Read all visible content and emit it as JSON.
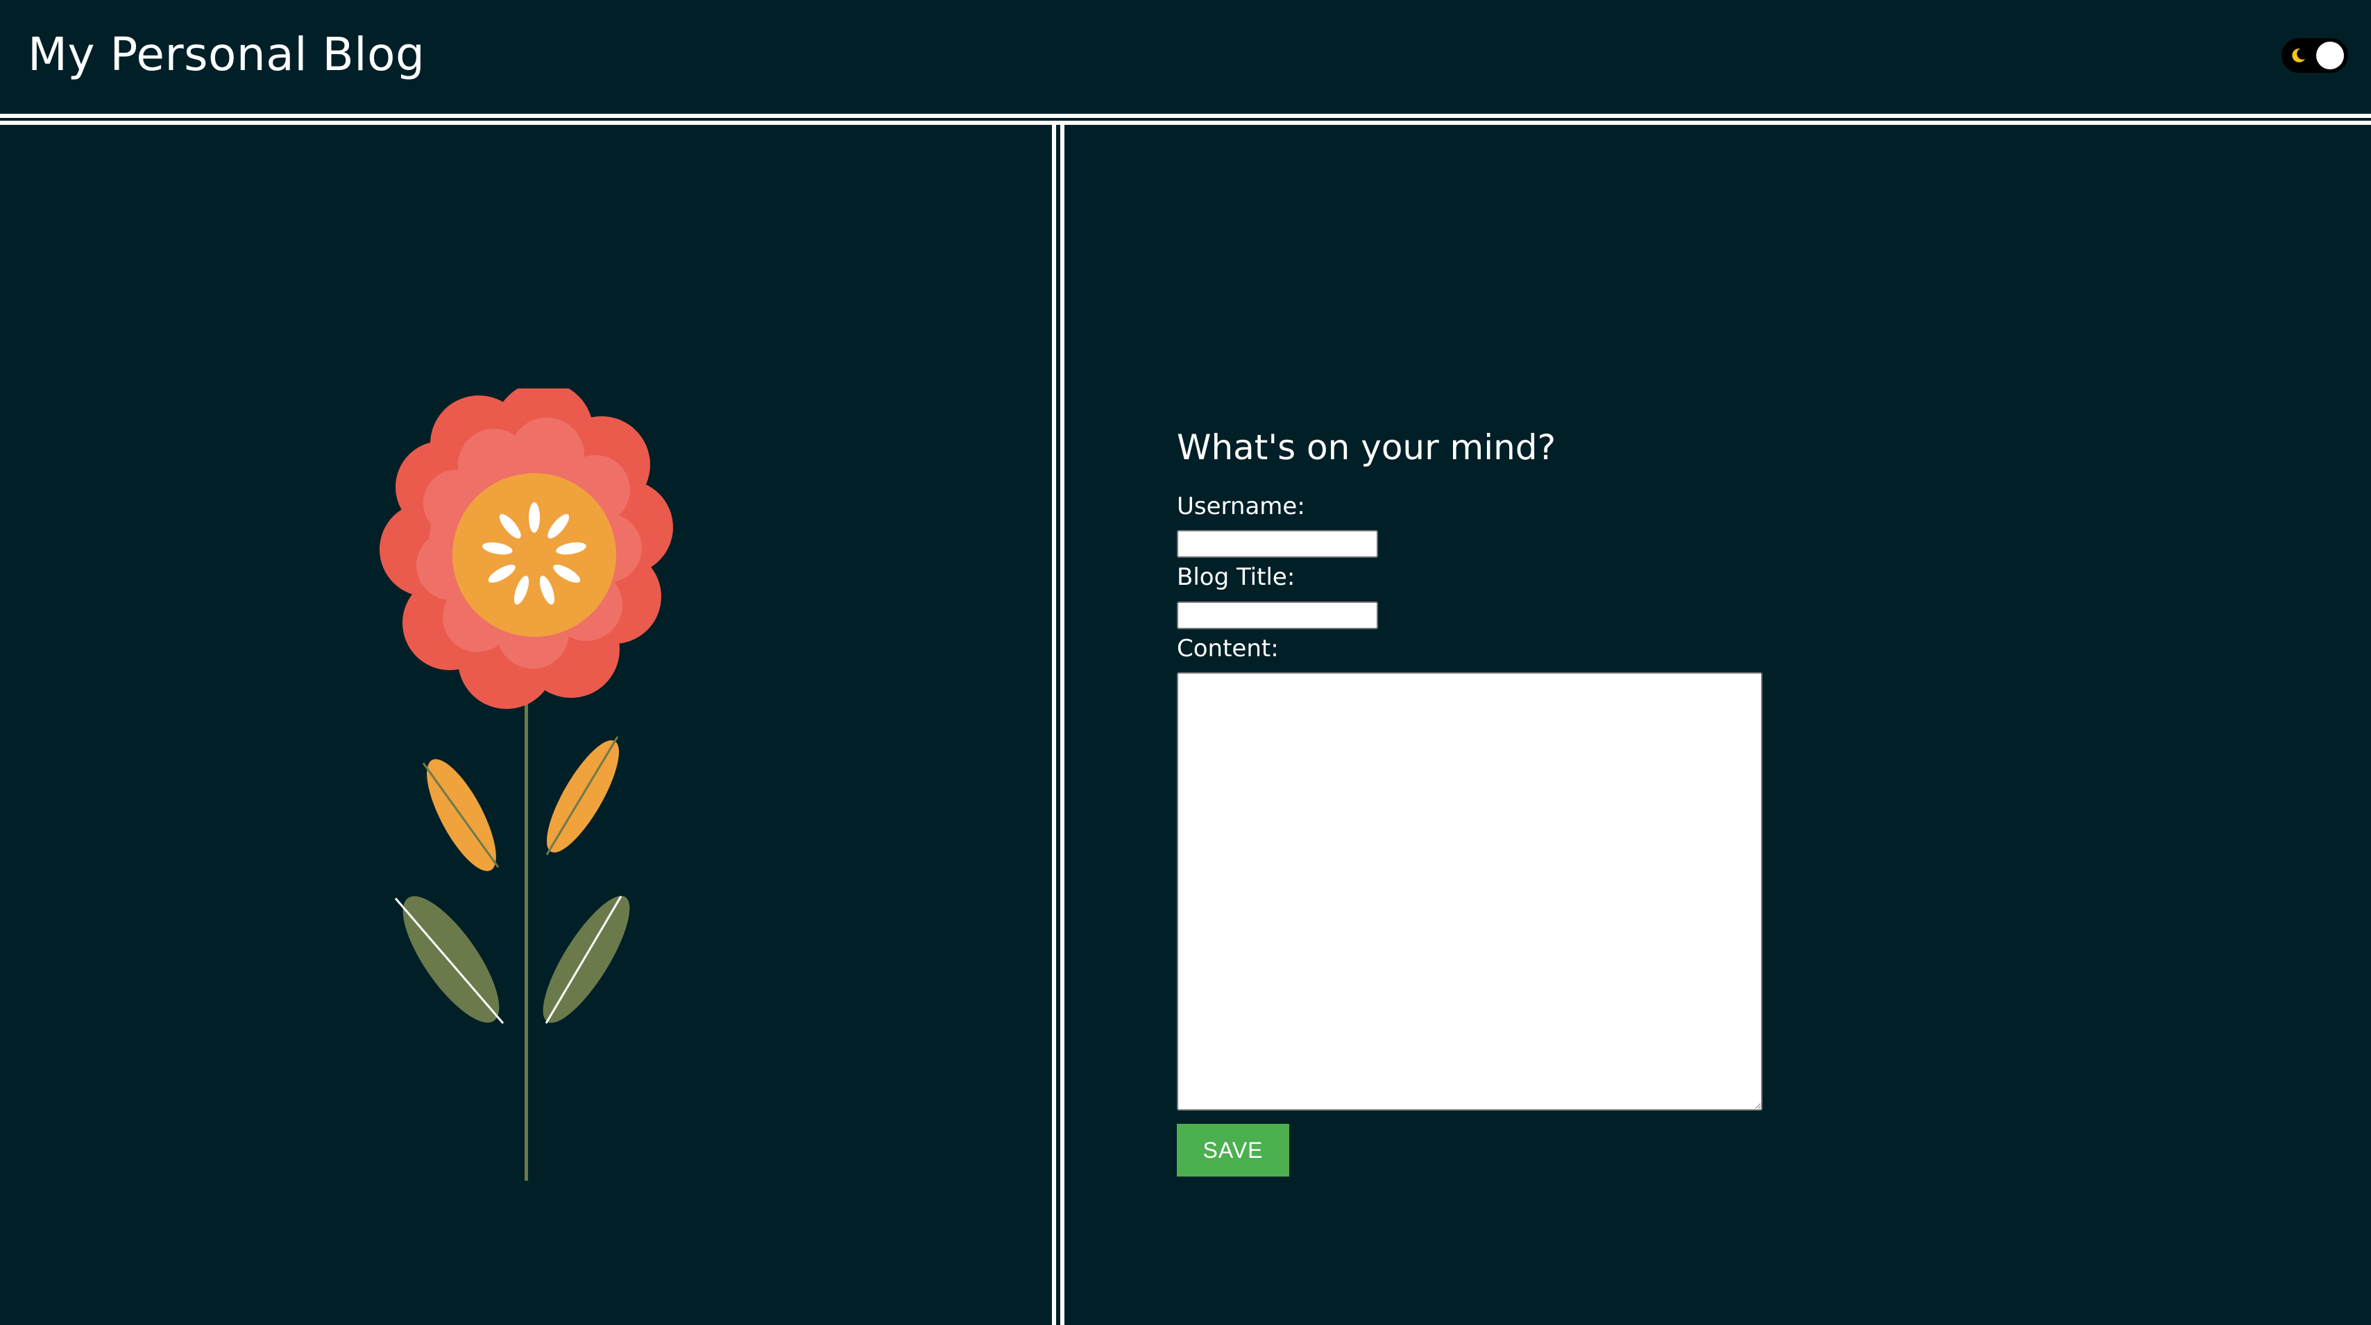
{
  "header": {
    "title": "My Personal Blog",
    "theme_toggle": {
      "icon": "moon-icon",
      "state": "dark",
      "moon_color": "#f5c518",
      "knob_color": "#ffffff"
    }
  },
  "form": {
    "heading": "What's on your mind?",
    "username_label": "Username:",
    "username_value": "",
    "title_label": "Blog Title:",
    "title_value": "",
    "content_label": "Content:",
    "content_value": "",
    "save_label": "SAVE"
  },
  "illustration": {
    "icon": "flower-illustration",
    "petal_outer_color": "#ea5b4d",
    "petal_inner_color": "#ef7066",
    "center_color": "#f0a23d",
    "stem_color": "#6b7a4b",
    "upper_leaf_color": "#f0a23d",
    "lower_leaf_color": "#6b7a4b"
  },
  "colors": {
    "background": "#011f27",
    "accent": "#4caf50",
    "divider": "#ffffff"
  }
}
